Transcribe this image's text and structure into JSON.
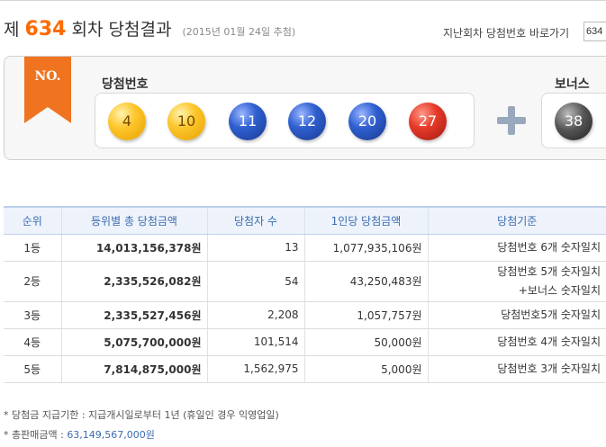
{
  "header": {
    "title_prefix": "제",
    "draw_number": "634",
    "title_suffix": "회차 당첨결과",
    "draw_date": "(2015년 01월 24일 추첨)",
    "goto_label": "지난회차 당첨번호 바로가기",
    "goto_value": "634"
  },
  "panel": {
    "badge": "NO.",
    "win_label": "당첨번호",
    "bonus_label": "보너스",
    "numbers": [
      {
        "value": "4",
        "color": "yellow"
      },
      {
        "value": "10",
        "color": "yellow"
      },
      {
        "value": "11",
        "color": "blue"
      },
      {
        "value": "12",
        "color": "blue"
      },
      {
        "value": "20",
        "color": "blue"
      },
      {
        "value": "27",
        "color": "red"
      }
    ],
    "bonus": {
      "value": "38",
      "color": "gray"
    }
  },
  "table": {
    "headers": [
      "순위",
      "등위별 총 당첨금액",
      "당첨자 수",
      "1인당 당첨금액",
      "당첨기준"
    ],
    "rows": [
      {
        "rank": "1등",
        "total": "14,013,156,378원",
        "count": "13",
        "per": "1,077,935,106원",
        "criteria": [
          "당첨번호 6개 숫자일치"
        ]
      },
      {
        "rank": "2등",
        "total": "2,335,526,082원",
        "count": "54",
        "per": "43,250,483원",
        "criteria": [
          "당첨번호 5개 숫자일치",
          "+보너스 숫자일치"
        ]
      },
      {
        "rank": "3등",
        "total": "2,335,527,456원",
        "count": "2,208",
        "per": "1,057,757원",
        "criteria": [
          "당첨번호5개 숫자일치"
        ]
      },
      {
        "rank": "4등",
        "total": "5,075,700,000원",
        "count": "101,514",
        "per": "50,000원",
        "criteria": [
          "당첨번호 4개 숫자일치"
        ]
      },
      {
        "rank": "5등",
        "total": "7,814,875,000원",
        "count": "1,562,975",
        "per": "5,000원",
        "criteria": [
          "당첨번호 3개 숫자일치"
        ]
      }
    ]
  },
  "notes": {
    "deadline": "* 당첨금 지급기한 : 지급개시일로부터 1년 (휴일인 경우 익영업일)",
    "sales_label": "* 총판매금액 :",
    "sales_amount": "63,149,567,000원"
  },
  "colors": {
    "accent_orange": "#ff6a00",
    "header_blue": "#3a6bb0"
  }
}
